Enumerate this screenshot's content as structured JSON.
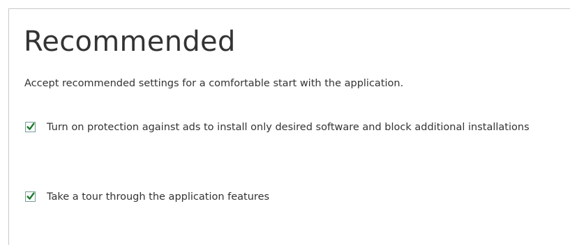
{
  "page": {
    "title": "Recommended",
    "subtitle": "Accept recommended settings for a comfortable start with the application."
  },
  "options": [
    {
      "label": "Turn on protection against ads to install only desired software and block additional installations",
      "checked": true,
      "icon": "checkmark-icon"
    },
    {
      "label": "Take a tour through the application features",
      "checked": true,
      "icon": "checkmark-icon"
    }
  ],
  "colors": {
    "check": "#1a7a2a",
    "text": "#333333",
    "checkbox_border": "#7a9c9a",
    "panel_border": "#c8c8c8"
  }
}
